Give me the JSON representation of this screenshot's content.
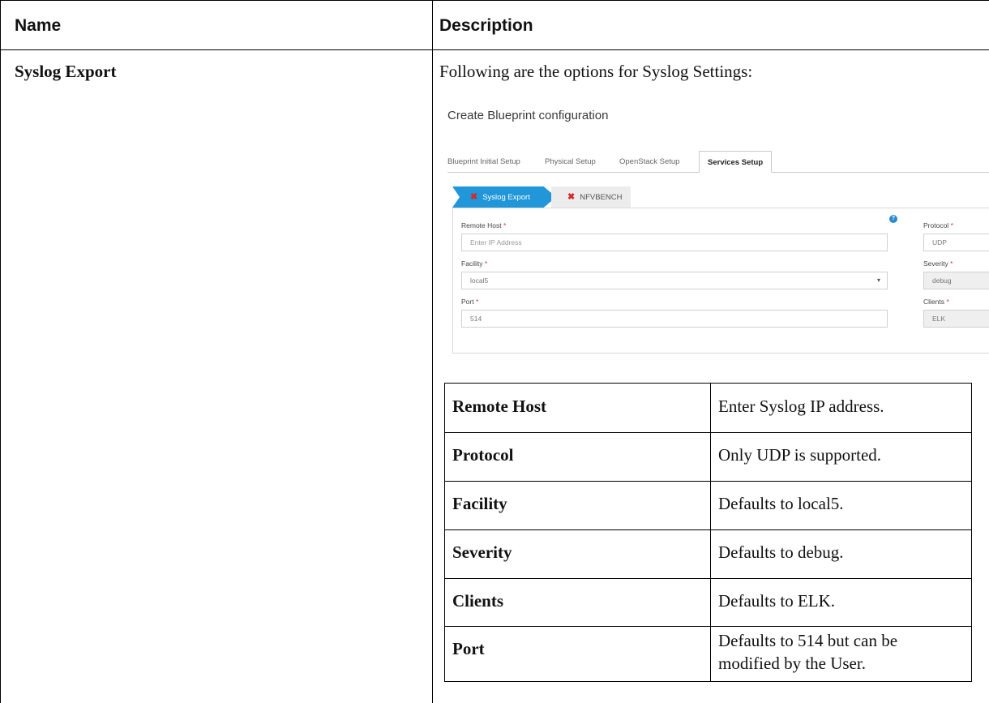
{
  "header": {
    "name": "Name",
    "description": "Description"
  },
  "row": {
    "name": "Syslog Export",
    "intro": "Following are the options for Syslog Settings:"
  },
  "screenshot": {
    "title": "Create Blueprint configuration",
    "tabs": [
      "Blueprint Initial Setup",
      "Physical Setup",
      "OpenStack Setup",
      "Services Setup"
    ],
    "active_tab": "Services Setup",
    "steps": [
      "Syslog Export",
      "NFVBENCH"
    ],
    "fields": {
      "remote_host": {
        "label": "Remote Host",
        "placeholder": "Enter IP Address"
      },
      "facility": {
        "label": "Facility",
        "value": "local5"
      },
      "port": {
        "label": "Port",
        "value": "514"
      },
      "protocol": {
        "label": "Protocol",
        "value": "UDP"
      },
      "severity": {
        "label": "Severity",
        "value": "debug"
      },
      "clients": {
        "label": "Clients",
        "value": "ELK"
      }
    },
    "required_mark": "*",
    "info_icon": "info-icon",
    "step_error_icon": "x-icon",
    "colors": {
      "step_active": "#2196d9",
      "required": "#e03030",
      "error_x": "#d42a2a"
    }
  },
  "options": [
    {
      "name": "Remote Host",
      "desc": "Enter Syslog IP address."
    },
    {
      "name": "Protocol",
      "desc": "Only UDP is supported."
    },
    {
      "name": "Facility",
      "desc": "Defaults to local5."
    },
    {
      "name": "Severity",
      "desc": "Defaults to debug."
    },
    {
      "name": "Clients",
      "desc": "Defaults to ELK."
    },
    {
      "name": "Port",
      "desc_line1": "Defaults to 514 but can be",
      "desc_line2": "modified by the User."
    }
  ]
}
